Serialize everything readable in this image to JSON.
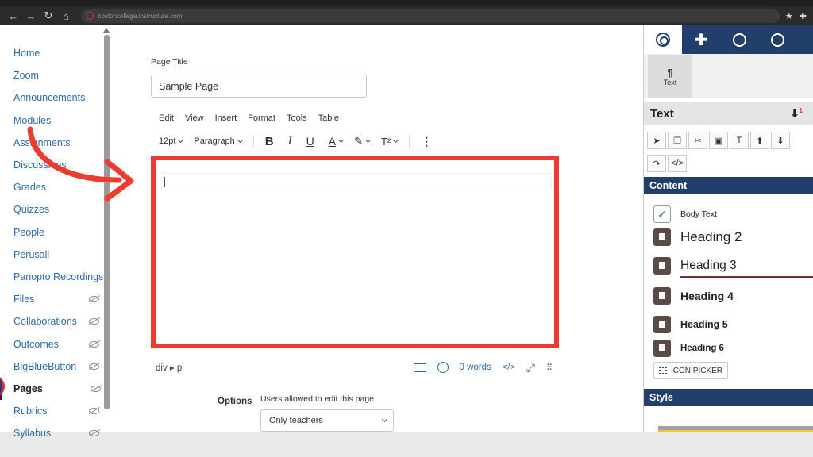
{
  "browser": {
    "url": "bostoncollege.instructure.com"
  },
  "sidebar": {
    "items": [
      {
        "label": "Home"
      },
      {
        "label": "Zoom"
      },
      {
        "label": "Announcements"
      },
      {
        "label": "Modules"
      },
      {
        "label": "Assignments"
      },
      {
        "label": "Discussions"
      },
      {
        "label": "Grades"
      },
      {
        "label": "Quizzes"
      },
      {
        "label": "People"
      },
      {
        "label": "Perusall"
      },
      {
        "label": "Panopto Recordings"
      },
      {
        "label": "Files"
      },
      {
        "label": "Collaborations"
      },
      {
        "label": "Outcomes"
      },
      {
        "label": "BigBlueButton"
      },
      {
        "label": "Pages"
      },
      {
        "label": "Rubrics"
      },
      {
        "label": "Syllabus"
      }
    ]
  },
  "editor": {
    "page_title_label": "Page Title",
    "page_title_value": "Sample Page",
    "menu": [
      "Edit",
      "View",
      "Insert",
      "Format",
      "Tools",
      "Table"
    ],
    "font_size": "12pt",
    "block_format": "Paragraph",
    "superscript_label": "T²",
    "path": "div ▸ p",
    "word_count": "0 words",
    "options_label": "Options",
    "options_desc": "Users allowed to edit this page",
    "options_value": "Only teachers"
  },
  "right_panel": {
    "tile_label": "Text",
    "header": "Text",
    "content_title": "Content",
    "items": [
      "Body Text",
      "Heading 2",
      "Heading 3",
      "Heading 4",
      "Heading 5",
      "Heading 6"
    ],
    "icon_picker": "ICON PICKER",
    "style_title": "Style",
    "badge": "1"
  },
  "colors": {
    "accent": "#223f6b",
    "highlight_box": "#ee3b31",
    "link": "#2d6ca8"
  }
}
